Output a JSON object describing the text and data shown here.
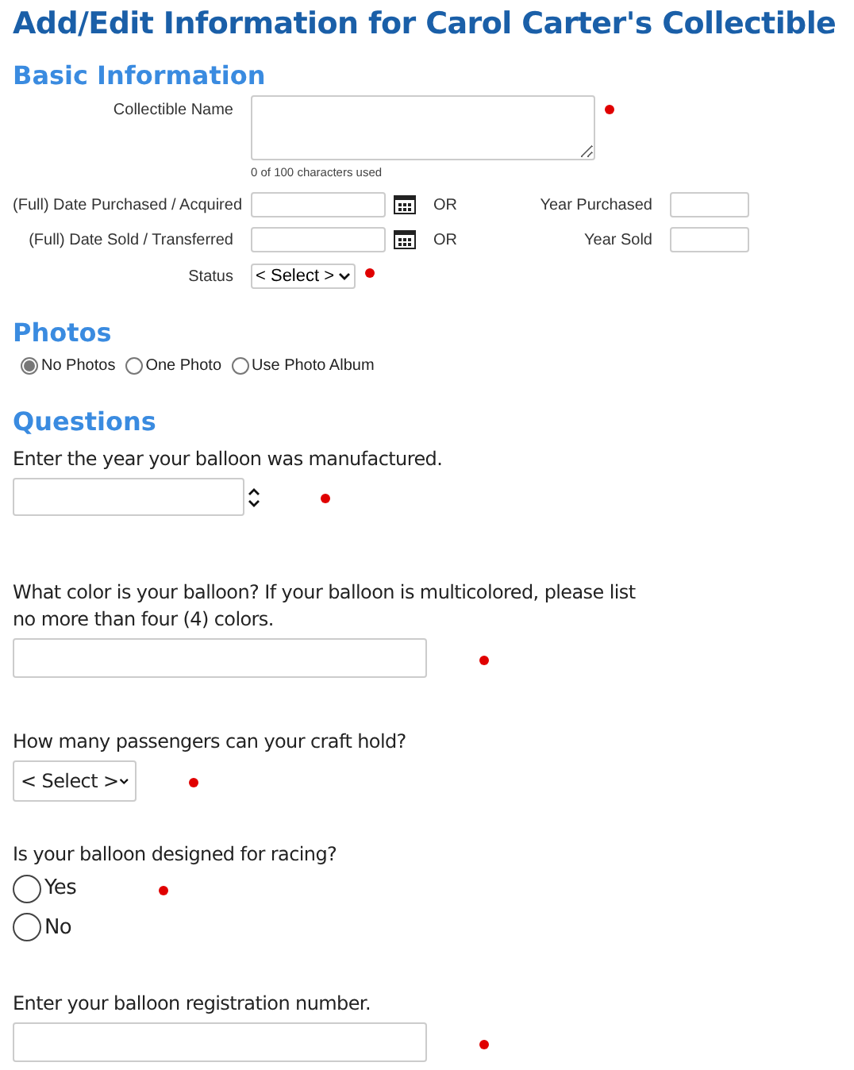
{
  "title": "Add/Edit Information for Carol Carter's Collectible",
  "basic": {
    "heading": "Basic Information",
    "name_field": {
      "label": "Collectible Name",
      "required": true,
      "counter": "0 of 100 characters used"
    },
    "date_rows": [
      {
        "label": "(Full) Date Purchased / Acquired",
        "or": "OR",
        "year_label": "Year Purchased"
      },
      {
        "label": "(Full) Date Sold / Transferred",
        "or": "OR",
        "year_label": "Year Sold"
      }
    ],
    "status": {
      "label": "Status",
      "value": "< Select >",
      "required": true
    }
  },
  "photos": {
    "heading": "Photos",
    "options": [
      {
        "label": "No Photos",
        "selected": true
      },
      {
        "label": "One Photo",
        "selected": false
      },
      {
        "label": "Use Photo Album",
        "selected": false
      }
    ]
  },
  "questions": {
    "heading": "Questions",
    "items": [
      {
        "kind": "number",
        "text": "Enter the year your balloon was manufactured.",
        "required": true
      },
      {
        "kind": "text",
        "text": "What color is your balloon? If your balloon is multicolored, please list no more than four (4) colors.",
        "required": true
      },
      {
        "kind": "select",
        "text": "How many passengers can your craft hold?",
        "value": "< Select >",
        "required": true
      },
      {
        "kind": "radio",
        "text": "Is your balloon designed for racing?",
        "required": true,
        "options": [
          {
            "label": "Yes",
            "selected": false
          },
          {
            "label": "No",
            "selected": false
          }
        ]
      },
      {
        "kind": "text",
        "text": "Enter your balloon registration number.",
        "required": true
      }
    ]
  }
}
